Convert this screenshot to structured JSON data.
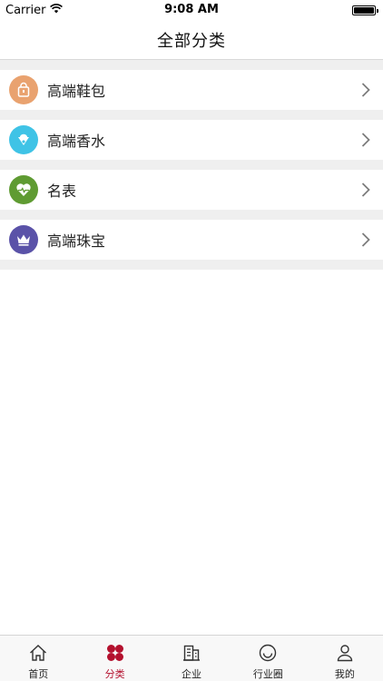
{
  "status_bar": {
    "carrier": "Carrier",
    "time": "9:08 AM"
  },
  "nav": {
    "title": "全部分类"
  },
  "categories": [
    {
      "label": "高端鞋包",
      "icon": "bag-icon",
      "color": "#e9a26f"
    },
    {
      "label": "高端香水",
      "icon": "perfume-icon",
      "color": "#3fc3e6"
    },
    {
      "label": "名表",
      "icon": "heart-pulse-icon",
      "color": "#5f9b32"
    },
    {
      "label": "高端珠宝",
      "icon": "crown-icon",
      "color": "#5a52a8"
    }
  ],
  "tab_bar": {
    "active_color": "#b4112e",
    "items": [
      {
        "label": "首页",
        "icon": "home-icon",
        "active": false
      },
      {
        "label": "分类",
        "icon": "category-icon",
        "active": true
      },
      {
        "label": "企业",
        "icon": "building-icon",
        "active": false
      },
      {
        "label": "行业圈",
        "icon": "smile-icon",
        "active": false
      },
      {
        "label": "我的",
        "icon": "user-icon",
        "active": false
      }
    ]
  }
}
